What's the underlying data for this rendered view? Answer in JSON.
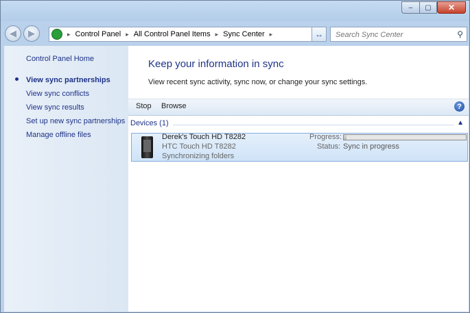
{
  "window": {
    "minimize_glyph": "–",
    "maximize_glyph": "▢",
    "close_glyph": "✕"
  },
  "nav": {
    "back_glyph": "◀",
    "forward_glyph": "▶",
    "address": [
      "Control Panel",
      "All Control Panel Items",
      "Sync Center"
    ],
    "crumb_sep": "▸",
    "dropdown_glyph": "▾",
    "refresh_glyph": "↔",
    "search_placeholder": "Search Sync Center",
    "search_glyph": "⚲"
  },
  "sidebar": {
    "home": "Control Panel Home",
    "items": [
      "View sync partnerships",
      "View sync conflicts",
      "View sync results",
      "Set up new sync partnerships",
      "Manage offline files"
    ],
    "active_index": 0
  },
  "main": {
    "title": "Keep your information in sync",
    "subtitle": "View recent sync activity, sync now, or change your sync settings."
  },
  "commands": {
    "stop": "Stop",
    "browse": "Browse",
    "help_glyph": "?"
  },
  "group": {
    "label": "Devices (1)",
    "collapse_glyph": "▲"
  },
  "device": {
    "name": "Derek's Touch HD T8282",
    "model": "HTC Touch HD T8282",
    "state": "Synchronizing folders",
    "progress_label": "Progress:",
    "progress": 0.02,
    "status_label": "Status:",
    "status": "Sync in progress"
  },
  "colors": {
    "link": "#1e3287",
    "sidebar_bg": "#e9f0f8",
    "frame": "#b9d1ea",
    "selection": "#cfe3f8",
    "close_button": "#c6412a"
  }
}
